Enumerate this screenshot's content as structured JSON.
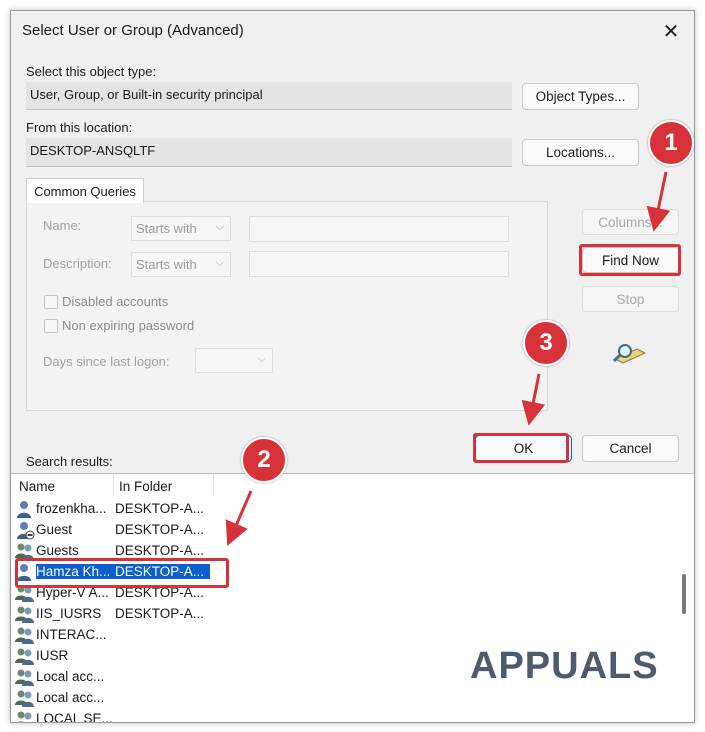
{
  "window": {
    "title": "Select User or Group (Advanced)",
    "close_glyph": "✕"
  },
  "object_type": {
    "label": "Select this object type:",
    "value": "User, Group, or Built-in security principal",
    "button": "Object Types..."
  },
  "location": {
    "label": "From this location:",
    "value": "DESKTOP-ANSQLTF",
    "button": "Locations..."
  },
  "common_queries": {
    "tab_label": "Common Queries",
    "name_label": "Name:",
    "name_mode": "Starts with",
    "description_label": "Description:",
    "description_mode": "Starts with",
    "disabled_accounts": "Disabled accounts",
    "non_expiring_password": "Non expiring password",
    "days_since_logon": "Days since last logon:"
  },
  "side_buttons": {
    "columns": "Columns...",
    "find_now": "Find Now",
    "stop": "Stop"
  },
  "dialog_buttons": {
    "ok": "OK",
    "cancel": "Cancel"
  },
  "results": {
    "label": "Search results:",
    "columns": [
      "Name",
      "In Folder"
    ],
    "rows": [
      {
        "name": "frozenkha...",
        "folder": "DESKTOP-A...",
        "icon": "user-icon"
      },
      {
        "name": "Guest",
        "folder": "DESKTOP-A...",
        "icon": "user-disabled-icon"
      },
      {
        "name": "Guests",
        "folder": "DESKTOP-A...",
        "icon": "group-icon"
      },
      {
        "name": "Hamza Kh...",
        "folder": "DESKTOP-A...",
        "icon": "user-icon"
      },
      {
        "name": "Hyper-V A...",
        "folder": "DESKTOP-A...",
        "icon": "group-icon"
      },
      {
        "name": "IIS_IUSRS",
        "folder": "DESKTOP-A...",
        "icon": "group-icon"
      },
      {
        "name": "INTERAC...",
        "folder": "",
        "icon": "group-icon"
      },
      {
        "name": "IUSR",
        "folder": "",
        "icon": "group-icon"
      },
      {
        "name": "Local acc...",
        "folder": "",
        "icon": "group-icon"
      },
      {
        "name": "Local acc...",
        "folder": "",
        "icon": "group-icon"
      },
      {
        "name": "LOCAL SE...",
        "folder": "",
        "icon": "group-icon"
      }
    ]
  },
  "callouts": [
    "1",
    "2",
    "3"
  ],
  "watermark": "APPUALS",
  "colors": {
    "highlight": "#d7323a",
    "selection": "#0b5fcf",
    "callout": "#d7323a"
  }
}
